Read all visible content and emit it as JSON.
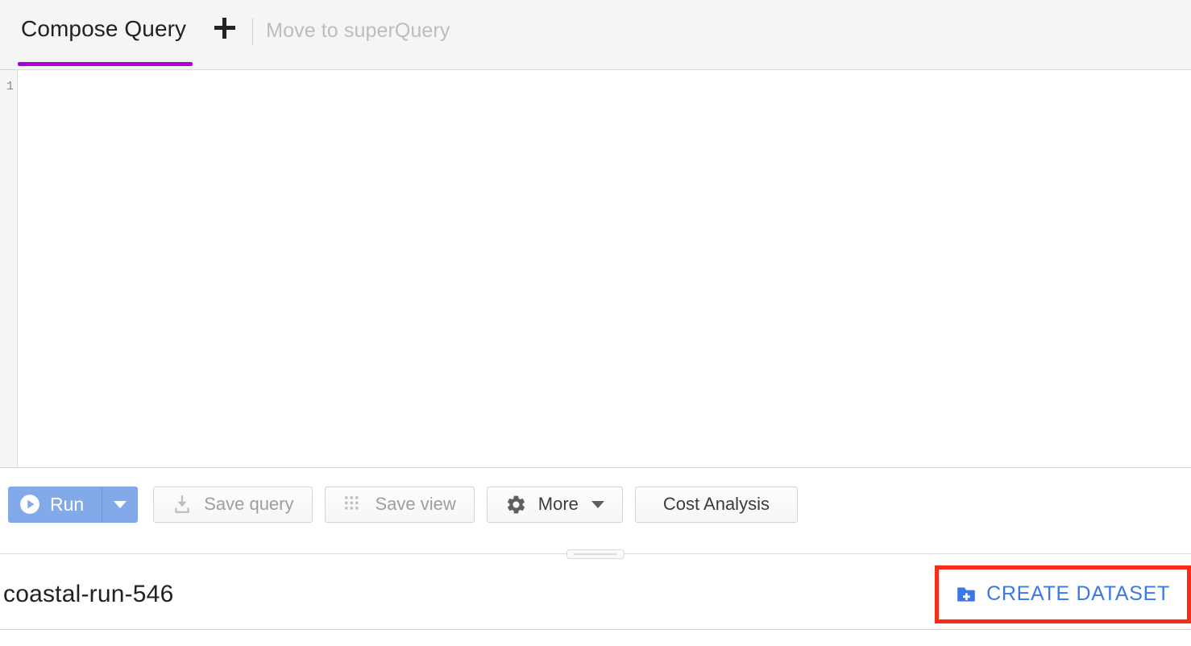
{
  "window": {
    "app": "BigQuery Query Editor",
    "accent_purple": "#ac00d8",
    "accent_blue": "#3b78e7",
    "run_button_blue": "#82a9e8",
    "highlight_red": "#f82c17"
  },
  "tabbar": {
    "active_tab": "Compose Query",
    "new_tab_icon": "plus-icon",
    "move_link": "Move to superQuery"
  },
  "editor": {
    "line_numbers": [
      "1"
    ],
    "code": "",
    "placeholder": ""
  },
  "toolbar": {
    "run": {
      "label": "Run",
      "icon": "play-circle-icon",
      "dropdown_icon": "chevron-down-icon"
    },
    "save_query": {
      "label": "Save query",
      "icon": "download-save-icon",
      "enabled": false
    },
    "save_view": {
      "label": "Save view",
      "icon": "grid-dots-icon",
      "enabled": false
    },
    "more": {
      "label": "More",
      "icon": "gear-icon",
      "dropdown_icon": "chevron-down-icon"
    },
    "cost_analysis": {
      "label": "Cost Analysis"
    }
  },
  "splitter": {
    "handle_icon": "drag-handle-icon"
  },
  "project": {
    "name": "coastal-run-546",
    "create_dataset": {
      "label": "CREATE DATASET",
      "icon": "folder-add-icon"
    }
  }
}
